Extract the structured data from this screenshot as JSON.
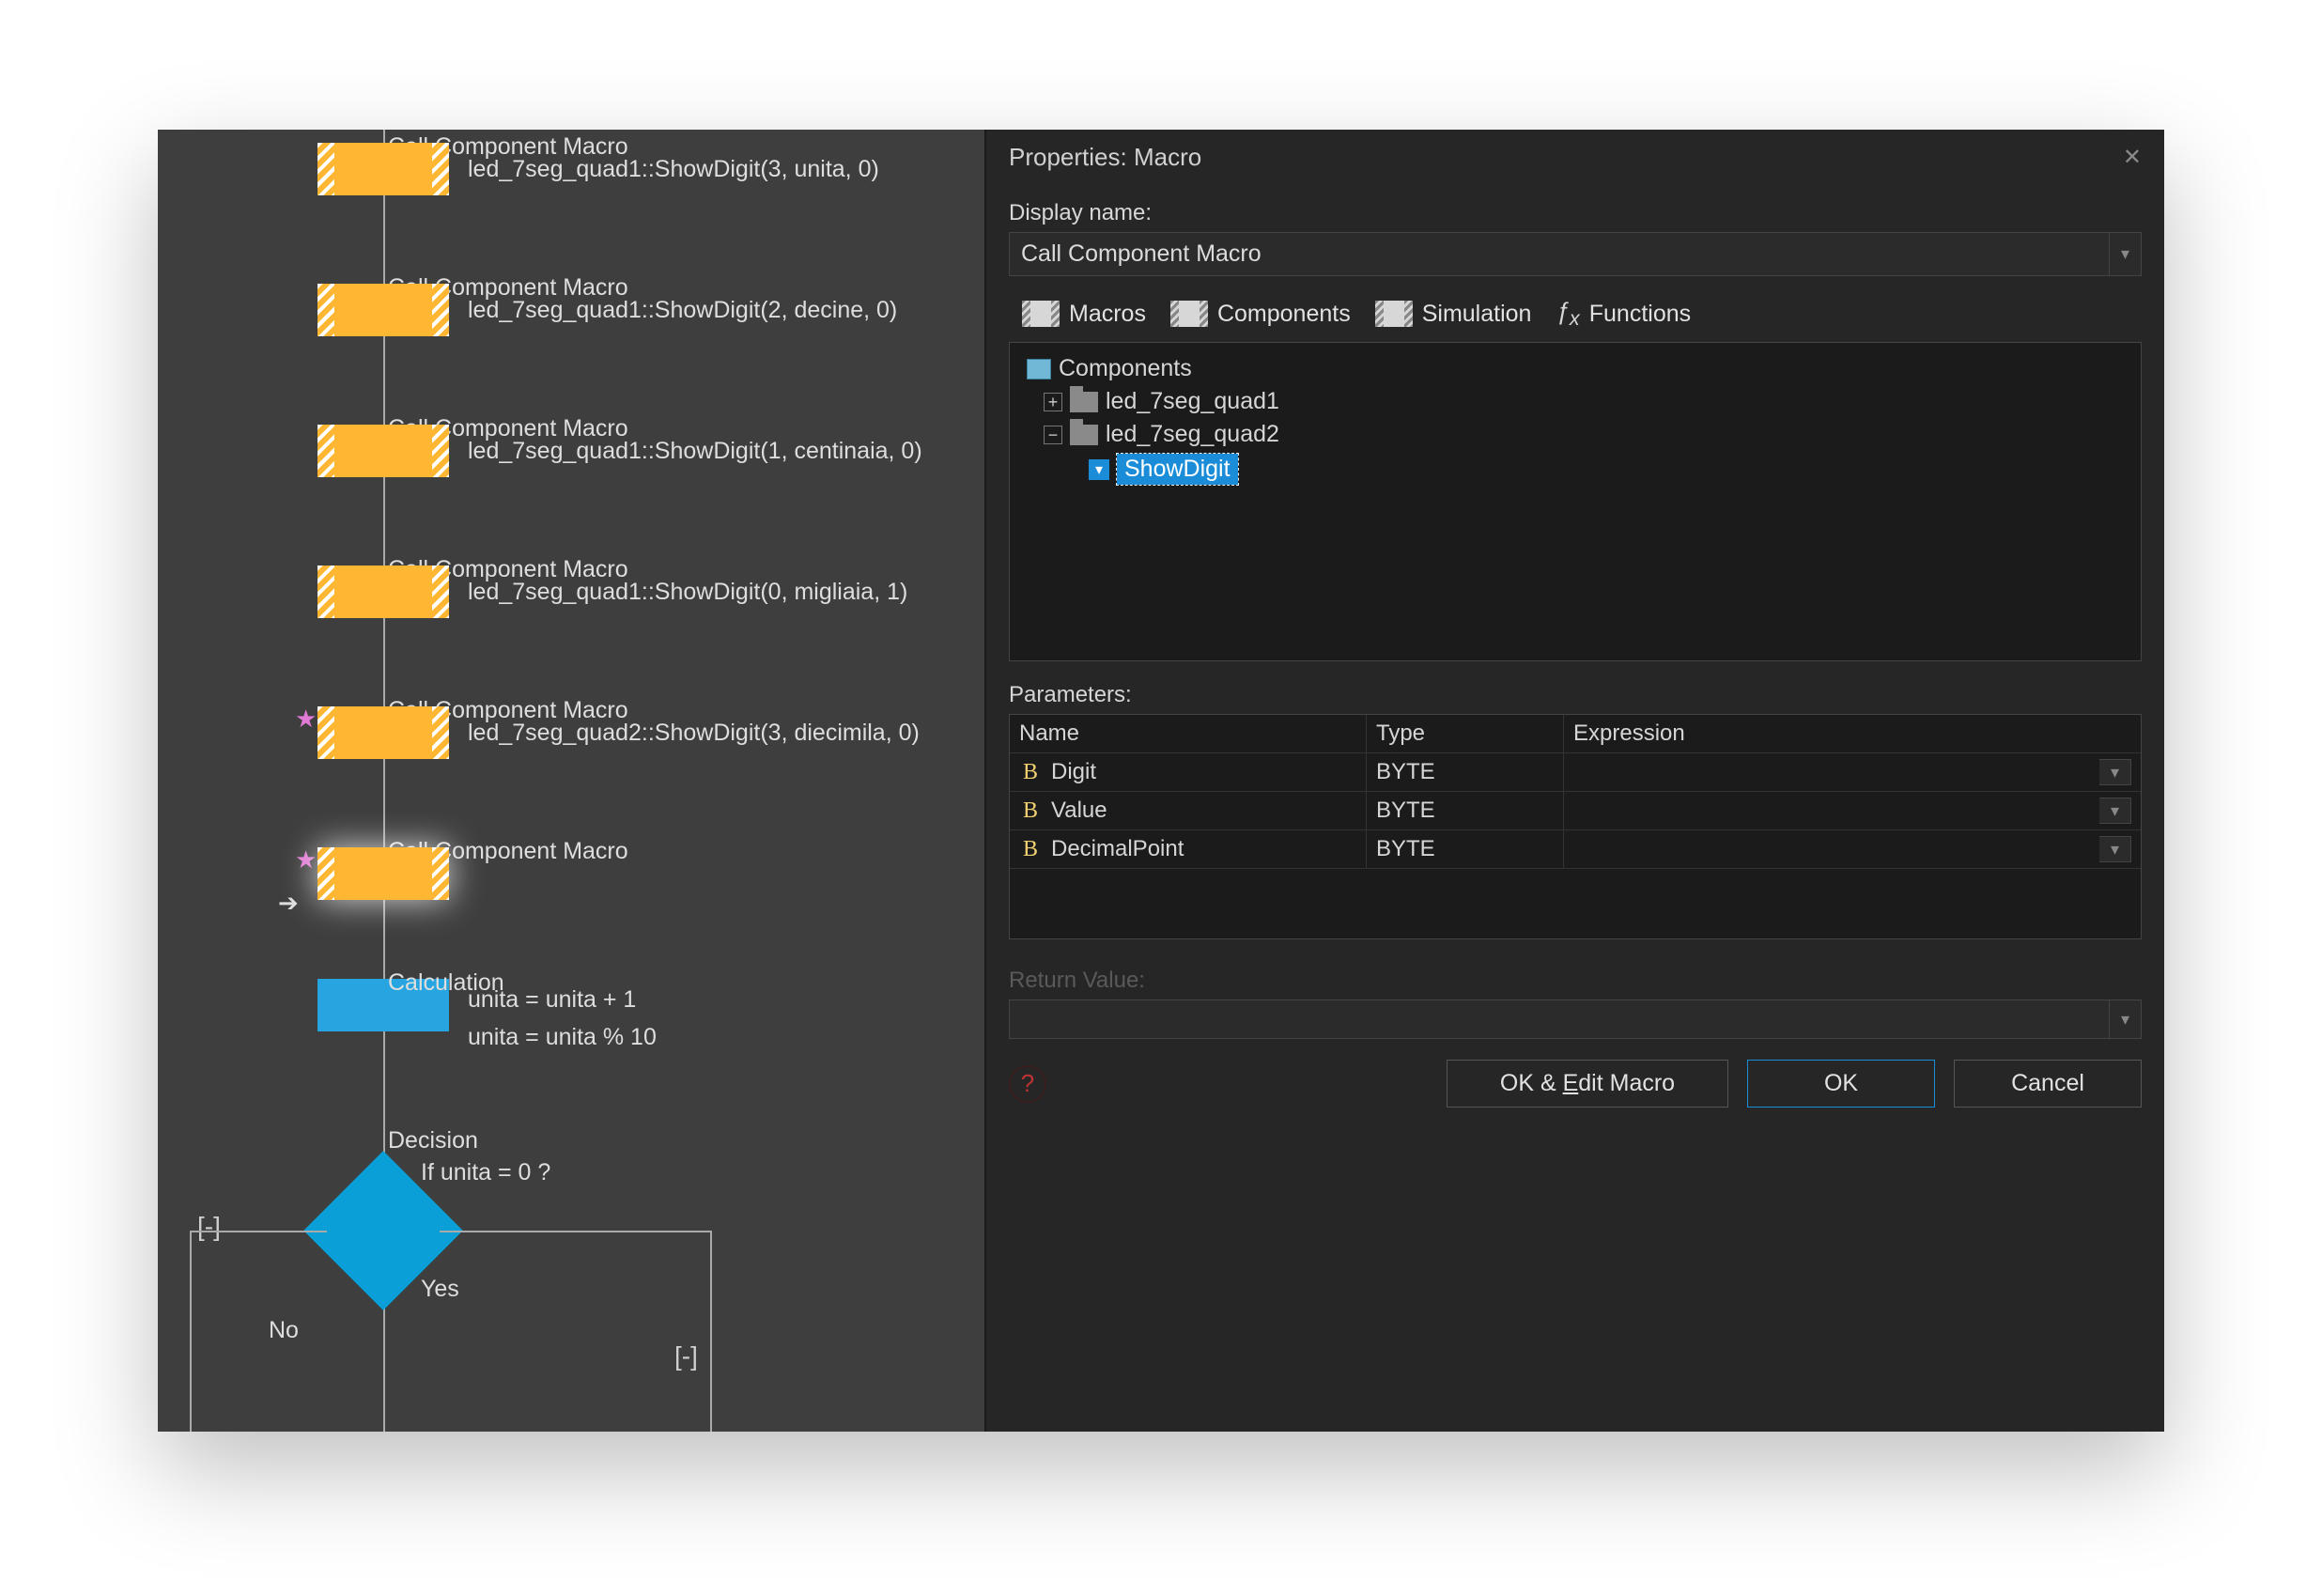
{
  "flow": {
    "items": [
      {
        "title": "Call Component Macro",
        "sub": "led_7seg_quad1::ShowDigit(3, unita, 0)",
        "star": false
      },
      {
        "title": "Call Component Macro",
        "sub": "led_7seg_quad1::ShowDigit(2, decine, 0)",
        "star": false
      },
      {
        "title": "Call Component Macro",
        "sub": "led_7seg_quad1::ShowDigit(1, centinaia, 0)",
        "star": false
      },
      {
        "title": "Call Component Macro",
        "sub": "led_7seg_quad1::ShowDigit(0, migliaia, 1)",
        "star": false
      },
      {
        "title": "Call Component Macro",
        "sub": "led_7seg_quad2::ShowDigit(3, diecimila, 0)",
        "star": true
      },
      {
        "title": "Call Component Macro",
        "sub": "",
        "star": true
      }
    ],
    "calc": {
      "title": "Calculation",
      "line1": "unita = unita + 1",
      "line2": "unita = unita % 10"
    },
    "decision": {
      "title": "Decision",
      "expr": "If  unita = 0 ?",
      "yes": "Yes",
      "no": "No",
      "lb": "[-]",
      "rb": "[-]"
    }
  },
  "panel": {
    "title": "Properties: Macro",
    "display_label": "Display name:",
    "display_value": "Call Component Macro",
    "tabs": {
      "macros": "Macros",
      "components": "Components",
      "simulation": "Simulation",
      "functions": "Functions"
    },
    "tree": {
      "root": "Components",
      "n1": "led_7seg_quad1",
      "n2": "led_7seg_quad2",
      "leaf": "ShowDigit"
    },
    "params_label": "Parameters:",
    "param_headers": {
      "name": "Name",
      "type": "Type",
      "expr": "Expression"
    },
    "params": [
      {
        "name": "Digit",
        "type": "BYTE",
        "expr": ""
      },
      {
        "name": "Value",
        "type": "BYTE",
        "expr": ""
      },
      {
        "name": "DecimalPoint",
        "type": "BYTE",
        "expr": ""
      }
    ],
    "return_label": "Return Value:",
    "return_value": "",
    "buttons": {
      "okedit": "OK & Edit Macro",
      "ok": "OK",
      "cancel": "Cancel",
      "edit_char": "E"
    }
  }
}
